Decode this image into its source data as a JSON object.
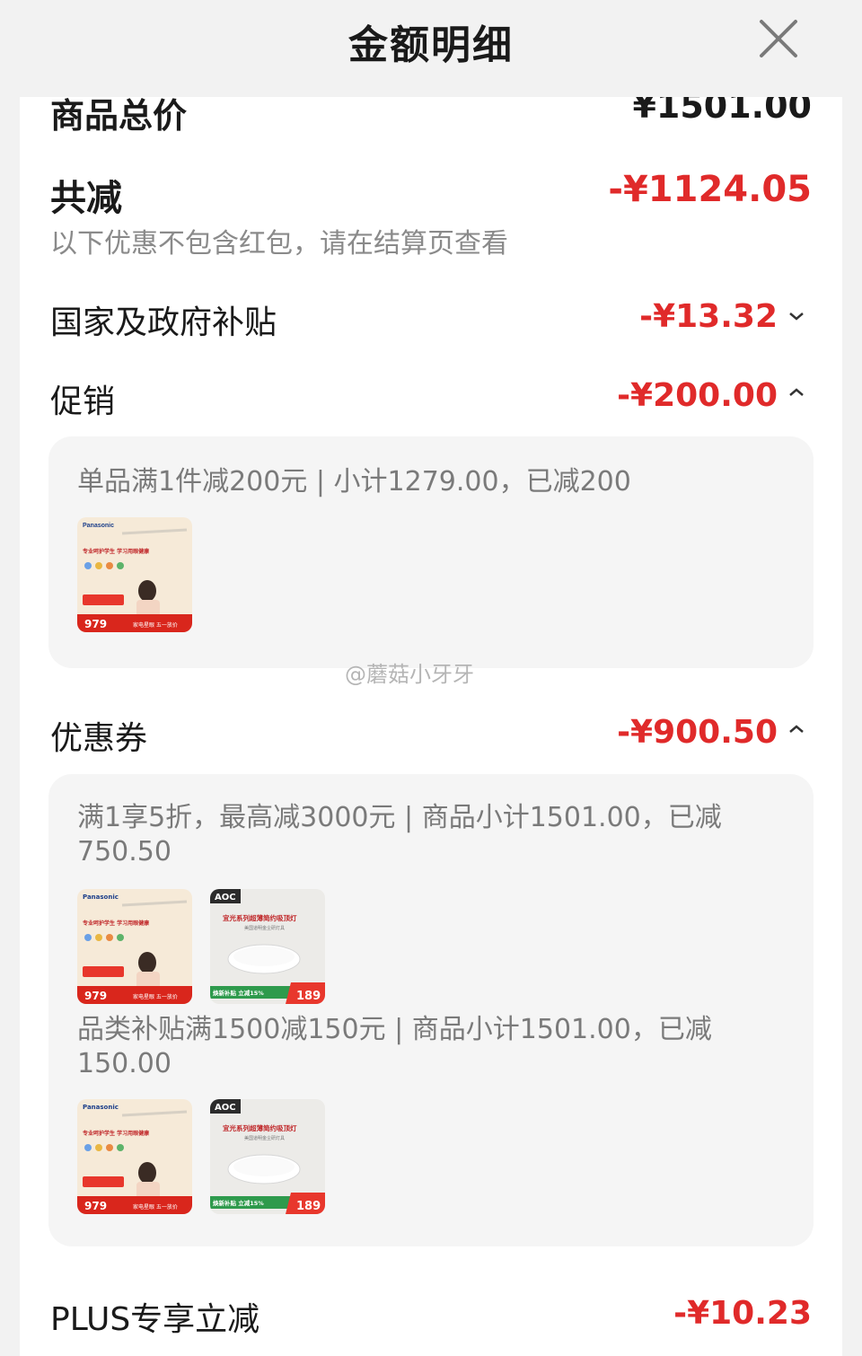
{
  "header": {
    "title": "金额明细"
  },
  "summary": {
    "total_label": "商品总价",
    "total_value": "¥1501.00",
    "reduce_label": "共减",
    "reduce_value": "-¥1124.05",
    "note": "以下优惠不包含红包，请在结算页查看"
  },
  "rows": {
    "subsidy": {
      "label": "国家及政府补贴",
      "value": "-¥13.32"
    },
    "promo": {
      "label": "促销",
      "value": "-¥200.00"
    },
    "coupon": {
      "label": "优惠券",
      "value": "-¥900.50"
    },
    "plus": {
      "label": "PLUS专享立减",
      "value": "-¥10.23"
    }
  },
  "promo_detail": {
    "rule": "单品满1件减200元 | 小计1279.00，已减200"
  },
  "coupon_detail": {
    "rule1": "满1享5折，最高减3000元 | 商品小计1501.00，已减750.50",
    "rule2": "品类补贴满1500减150元 | 商品小计1501.00，已减150.00"
  },
  "products": {
    "lamp": {
      "brand": "Panasonic",
      "headline": "专业呵护学生 学习用眼健康",
      "price": "979",
      "tag": "家电星眼 五一放价"
    },
    "ceiling": {
      "brand": "AOC",
      "headline": "宜光系列超薄简约吸顶灯",
      "sub": "美国道明金尘研灯具",
      "tag": "焕新补贴 立减15%",
      "price": "189"
    }
  },
  "watermark": "@蘑菇小牙牙",
  "colors": {
    "accent": "#e02a2a",
    "muted": "#8a8a8a",
    "box": "#f5f5f5"
  }
}
